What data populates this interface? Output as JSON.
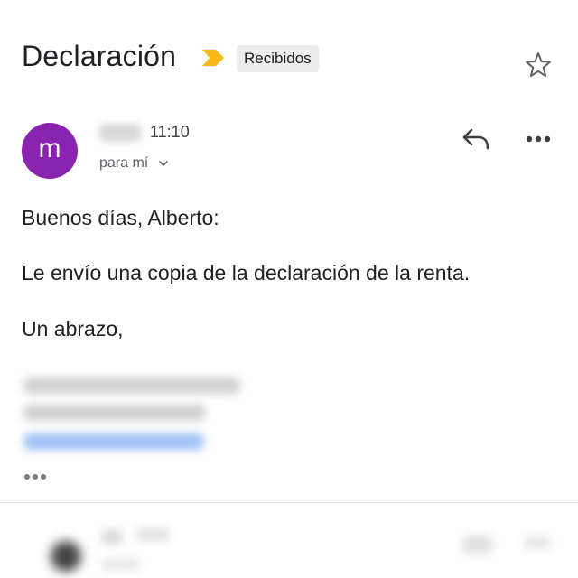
{
  "header": {
    "subject": "Declaración",
    "label": "Recibidos",
    "important_color": "#f9b81a"
  },
  "sender": {
    "avatar_letter": "m",
    "avatar_color": "#8a24b0",
    "time": "11:10",
    "recipient": "para mí"
  },
  "body": {
    "greeting": "Buenos días, Alberto:",
    "content": "Le envío una copia de la declaración de la renta.",
    "closing": "Un abrazo,"
  },
  "icons": {
    "important": "important-marker-icon",
    "star": "star-icon",
    "reply": "reply-icon",
    "more": "more-options-icon",
    "chevron": "chevron-down-icon",
    "trimmed": "show-trimmed-content-icon"
  }
}
